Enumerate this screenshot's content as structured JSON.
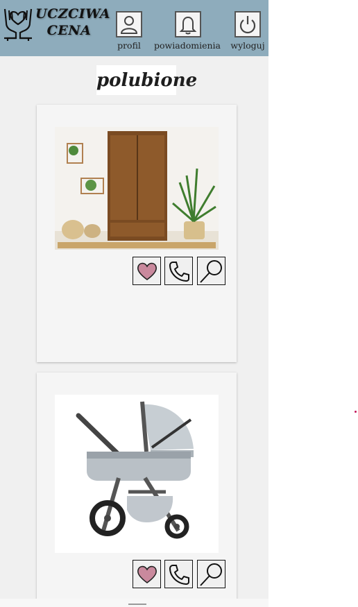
{
  "header": {
    "logo_line1": "UCZCIWA",
    "logo_line2": "CENA",
    "nav": [
      {
        "label": "profil",
        "icon": "user-icon"
      },
      {
        "label": "powiadomienia",
        "icon": "bell-icon"
      },
      {
        "label": "wyloguj",
        "icon": "power-icon"
      }
    ]
  },
  "page": {
    "title": "polubione"
  },
  "cards": [
    {
      "image": "wardrobe-photo",
      "actions": [
        "heart-icon",
        "phone-icon",
        "search-icon"
      ]
    },
    {
      "image": "stroller-photo",
      "actions": [
        "heart-icon",
        "phone-icon",
        "search-icon"
      ]
    }
  ],
  "colors": {
    "header_bg": "#8eacbc",
    "page_bg": "#f0f0f0",
    "heart_fill": "#c9899d"
  }
}
